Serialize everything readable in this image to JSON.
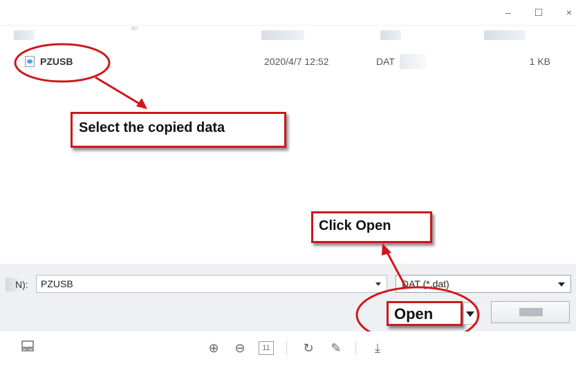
{
  "window": {
    "minimize_icon": "minimize-icon",
    "maximize_icon": "maximize-icon",
    "close_icon": "close-icon"
  },
  "file_row": {
    "name": "PZUSB",
    "modified": "2020/4/7 12:52",
    "type": "DAT",
    "size": "1 KB"
  },
  "annotations": {
    "select_data": "Select the copied data",
    "click_open": "Click Open",
    "color": "#d0161b"
  },
  "bottom": {
    "filename_label": "N):",
    "filename_value": "PZUSB",
    "file_type_value": "DAT (*.dat)",
    "open_label": "Open"
  },
  "toolbar": {
    "icons": [
      "layout-icon",
      "zoom-in-icon",
      "zoom-out-icon",
      "fit-page-icon",
      "rotate-icon",
      "edit-icon",
      "download-icon"
    ],
    "page_fit_text": "11"
  }
}
